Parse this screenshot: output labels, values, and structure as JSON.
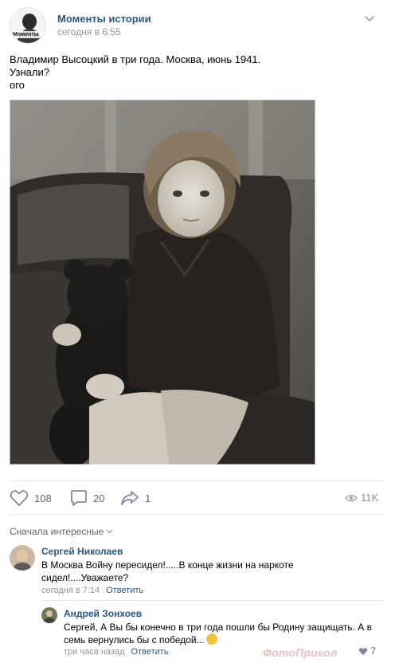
{
  "post": {
    "group_name": "Моменты истории",
    "avatar_text": "Моменты",
    "time": "сегодня в 6:55",
    "text": "Владимир Высоцкий в три года. Москва, июнь 1941.\nУзнали?\nого",
    "photo_desc_icon": "vintage-photo"
  },
  "actions": {
    "likes": "108",
    "comments": "20",
    "shares": "1",
    "views": "11K"
  },
  "comments_section": {
    "sort_label": "Сначала интересные",
    "comments": [
      {
        "author": "Сергей Николаев",
        "text": "В Москва Войну пересидел!.....В конце жизни на наркоте сидел!....Уважаете?",
        "time": "сегодня в 7:14",
        "reply_label": "Ответить"
      },
      {
        "author": "Андрей Зонхоев",
        "text": "Сергей, А Вы бы конечно в три года пошли бы Родину защищать. А в семь вернулись бы с победой...",
        "time": "три часа назад",
        "reply_label": "Ответить",
        "likes": "7"
      }
    ]
  },
  "watermark": "ФотоПрикол",
  "colors": {
    "link": "#2a5885",
    "muted": "#939393",
    "divider": "#e7e8ec"
  }
}
